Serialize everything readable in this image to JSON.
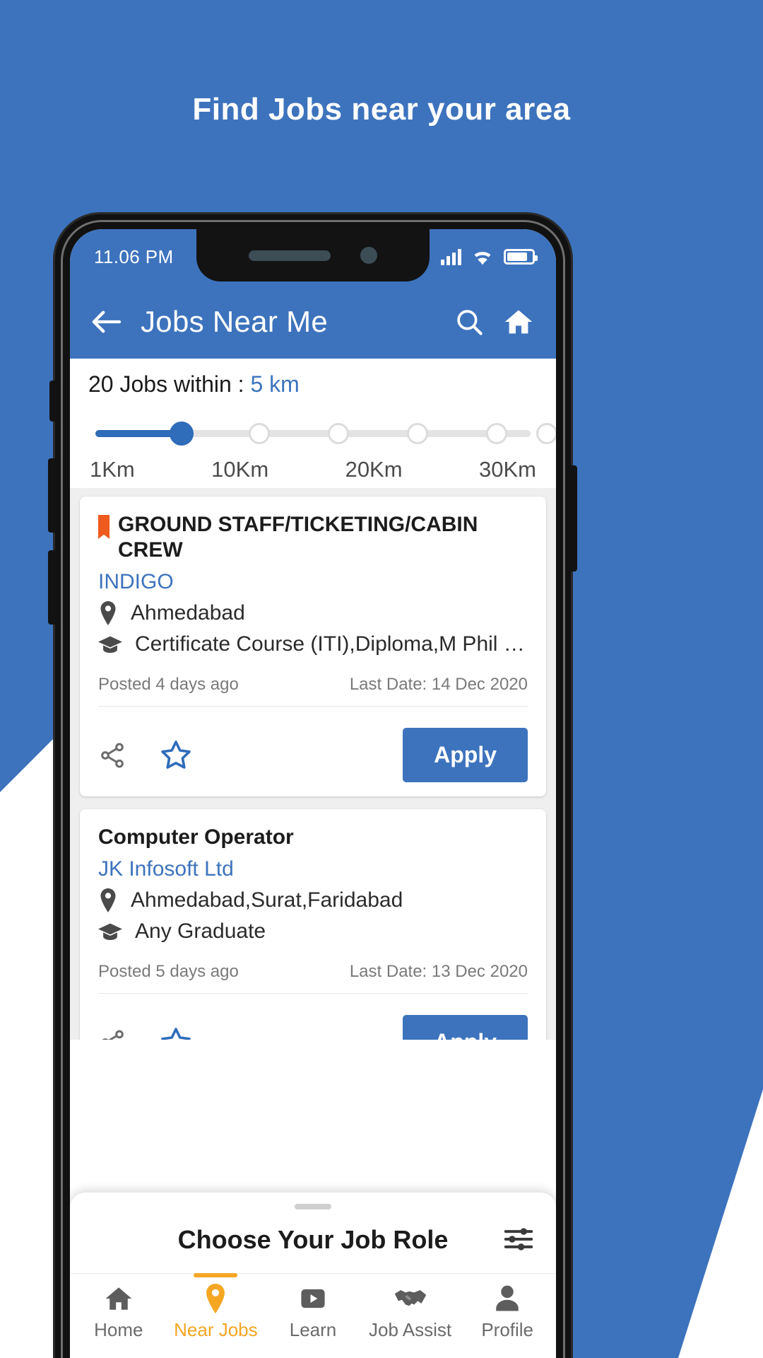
{
  "promo": {
    "headline": "Find Jobs near your area",
    "bg_color": "#3d73bd"
  },
  "status_bar": {
    "time": "11.06 PM",
    "signal_icon": "signal-bars-icon",
    "wifi_icon": "wifi-icon",
    "battery_icon": "battery-icon"
  },
  "app_bar": {
    "back_icon": "back-arrow-icon",
    "title": "Jobs Near Me",
    "search_icon": "search-icon",
    "home_icon": "home-icon",
    "accent": "#3d73bd"
  },
  "distance_filter": {
    "summary_prefix": "20 Jobs within : ",
    "summary_value": "5 km",
    "selected_index": 1,
    "ticks": 6,
    "labels": [
      "1Km",
      "10Km",
      "20Km",
      "30Km"
    ],
    "track_color": "#e3e3e3",
    "fill_color": "#2f6cb9"
  },
  "jobs": [
    {
      "flag": true,
      "title": "GROUND STAFF/TICKETING/CABIN CREW",
      "company": "INDIGO",
      "location_icon": "location-pin-icon",
      "location": "Ahmedabad",
      "education_icon": "graduation-cap-icon",
      "education": "Certificate Course (ITI),Diploma,M Phil / Ph.D,B...",
      "posted": "Posted 4 days ago",
      "last_date": "Last Date: 14 Dec 2020",
      "share_icon": "share-icon",
      "favorite_icon": "star-outline-icon",
      "apply_label": "Apply"
    },
    {
      "flag": false,
      "title": "Computer Operator",
      "company": "JK Infosoft Ltd",
      "location_icon": "location-pin-icon",
      "location": "Ahmedabad,Surat,Faridabad",
      "education_icon": "graduation-cap-icon",
      "education": "Any Graduate",
      "posted": "Posted 5 days ago",
      "last_date": "Last Date: 13 Dec 2020",
      "share_icon": "share-icon",
      "favorite_icon": "star-outline-icon",
      "apply_label": "Apply"
    }
  ],
  "sheet": {
    "title": "Choose Your Job Role",
    "filter_icon": "filter-sliders-icon"
  },
  "bottom_nav": {
    "active_index": 1,
    "active_color": "#f5a623",
    "items": [
      {
        "label": "Home",
        "icon": "home-icon"
      },
      {
        "label": "Near Jobs",
        "icon": "location-pin-icon"
      },
      {
        "label": "Learn",
        "icon": "play-video-icon"
      },
      {
        "label": "Job Assist",
        "icon": "handshake-icon"
      },
      {
        "label": "Profile",
        "icon": "person-icon"
      }
    ]
  }
}
